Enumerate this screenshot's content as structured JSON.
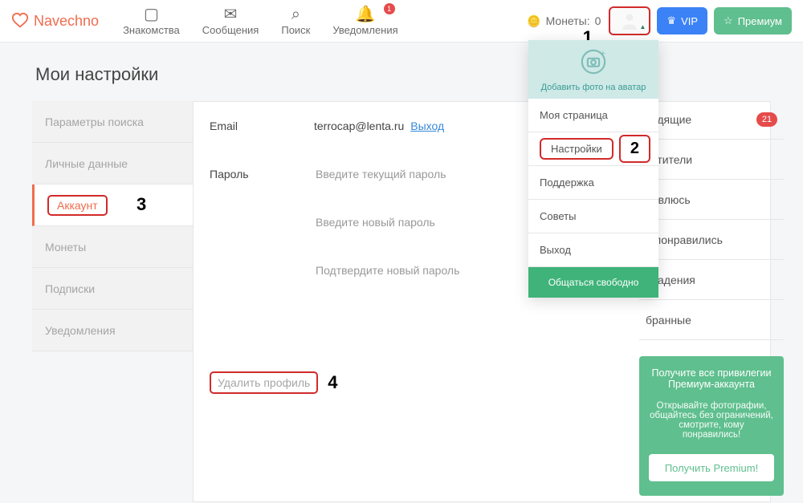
{
  "brand": "Navechno",
  "nav": {
    "dating": "Знакомства",
    "messages": "Сообщения",
    "search": "Поиск",
    "notifications": "Уведомления",
    "notif_badge": "1"
  },
  "coins": {
    "label": "Монеты:",
    "value": "0"
  },
  "buttons": {
    "vip": "VIP",
    "premium": "Премиум"
  },
  "markers": {
    "m1": "1",
    "m2": "2",
    "m3": "3",
    "m4": "4"
  },
  "page_title": "Мои настройки",
  "sidebar": {
    "items": [
      "Параметры поиска",
      "Личные данные",
      "Аккаунт",
      "Монеты",
      "Подписки",
      "Уведомления"
    ]
  },
  "form": {
    "email_label": "Email",
    "email_value": "terrocap@lenta.ru",
    "logout": "Выход",
    "password_label": "Пароль",
    "current_pw_ph": "Введите текущий пароль",
    "new_pw_ph": "Введите новый пароль",
    "confirm_pw_ph": "Подтвердите новый пароль",
    "delete": "Удалить профиль"
  },
  "dropdown": {
    "add_photo": "Добавить фото на аватар",
    "items": [
      "Моя страница",
      "Настройки",
      "Поддержка",
      "Советы",
      "Выход"
    ],
    "footer": "Общаться свободно"
  },
  "rightlist": {
    "items": [
      {
        "label": "ходящие",
        "badge": "21"
      },
      {
        "label": "сетители",
        "badge": ""
      },
      {
        "label": "равлюсь",
        "badge": ""
      },
      {
        "label": "е понравились",
        "badge": ""
      },
      {
        "label": "впадения",
        "badge": ""
      },
      {
        "label": "бранные",
        "badge": ""
      }
    ]
  },
  "promo": {
    "line1": "Получите все привилегии Премиум-аккаунта",
    "line2": "Открывайте фотографии, общайтесь без ограничений, смотрите, кому понравились!",
    "cta": "Получить Premium!"
  }
}
